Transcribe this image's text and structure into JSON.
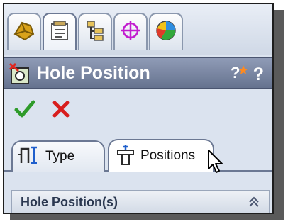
{
  "feature_tabs": [
    {
      "icon": "featuremanager-icon"
    },
    {
      "icon": "propertymanager-icon"
    },
    {
      "icon": "configurationmanager-icon"
    },
    {
      "icon": "dimxpert-icon"
    },
    {
      "icon": "display-manager-icon"
    }
  ],
  "header": {
    "title": "Hole Position",
    "help_label": "?"
  },
  "actions": {
    "ok_icon": "check-icon",
    "cancel_icon": "close-icon"
  },
  "property_tabs": [
    {
      "label": "Type",
      "icon": "hole-type-icon",
      "active": false
    },
    {
      "label": "Positions",
      "icon": "hole-positions-icon",
      "active": true
    }
  ],
  "section": {
    "title": "Hole Position(s)",
    "collapse_icon": "double-chevron-up-icon"
  },
  "colors": {
    "panel_bg": "#dbe3ef",
    "titlebar": "#7a86a2",
    "ok_green": "#2e9b2a",
    "cancel_red": "#d81e1e"
  }
}
